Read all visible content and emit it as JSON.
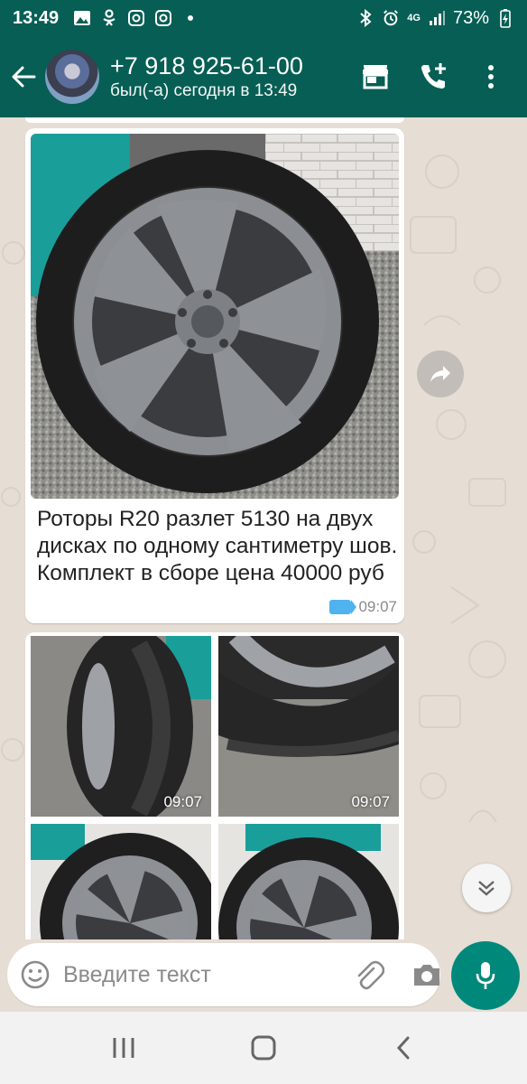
{
  "status_bar": {
    "time": "13:49",
    "battery": "73%",
    "network": "4G"
  },
  "app_bar": {
    "contact_name": "+7 918 925-61-00",
    "last_seen": "был(-а) сегодня в 13:49"
  },
  "messages": [
    {
      "type": "image_with_caption",
      "caption": "Роторы R20 разлет 5130 на двух дисках по одному сантиметру шов. Комплект в сборе цена 40000 руб",
      "time": "09:07"
    },
    {
      "type": "image_grid",
      "photos": [
        {
          "time": "09:07"
        },
        {
          "time": "09:07"
        },
        {
          "time": ""
        },
        {
          "time": ""
        }
      ]
    }
  ],
  "input": {
    "placeholder": "Введите текст"
  },
  "colors": {
    "header": "#075e54",
    "accent": "#00897b",
    "chat_bg": "#e6ddd4",
    "bubble": "#ffffff"
  }
}
